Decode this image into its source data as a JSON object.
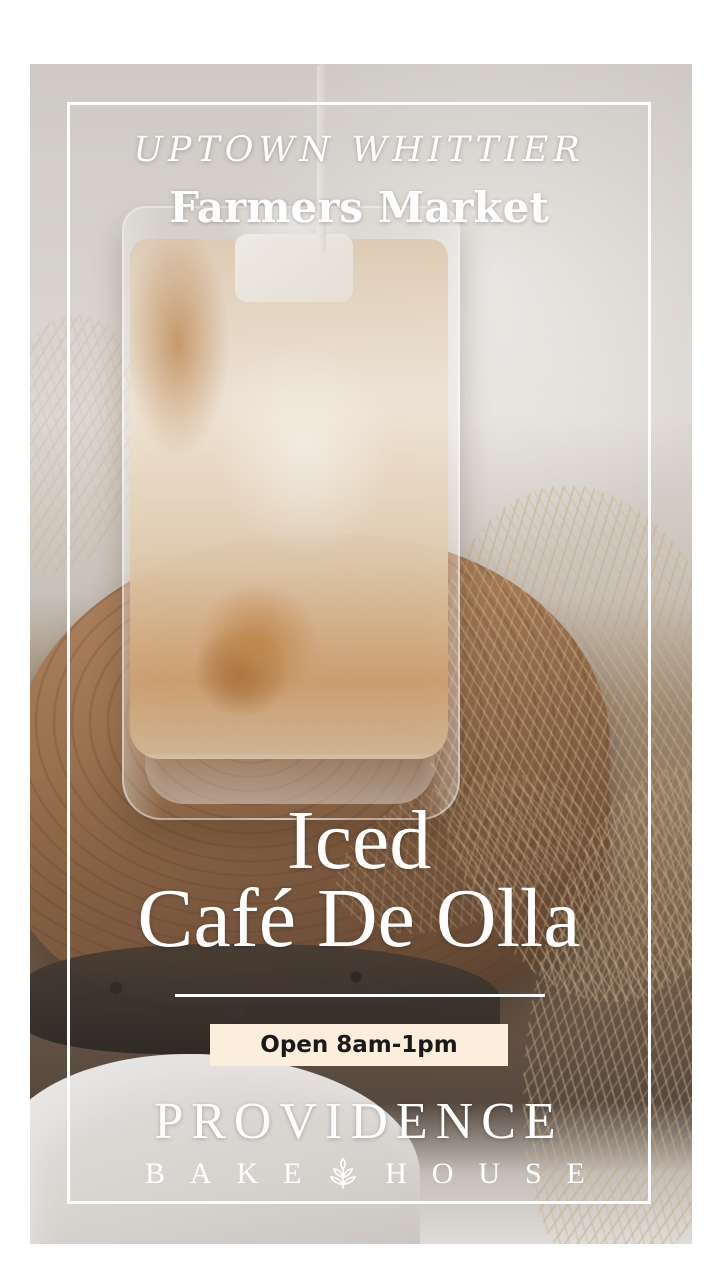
{
  "poster": {
    "kicker": "UPTOWN WHITTIER",
    "headline": "Farmers Market",
    "title_line1": "Iced",
    "title_line2": "Café De Olla",
    "hours": "Open 8am-1pm",
    "brand_name": "PROVIDENCE",
    "brand_sub_left": [
      "B",
      "A",
      "K",
      "E"
    ],
    "brand_sub_right": [
      "H",
      "O",
      "U",
      "S",
      "E"
    ],
    "brand_icon": "leaf-sprig-icon"
  },
  "colors": {
    "frame": "#ffffff",
    "text": "#ffffff",
    "badge_bg": "#fbeedd",
    "badge_text": "#1a1a1a"
  }
}
